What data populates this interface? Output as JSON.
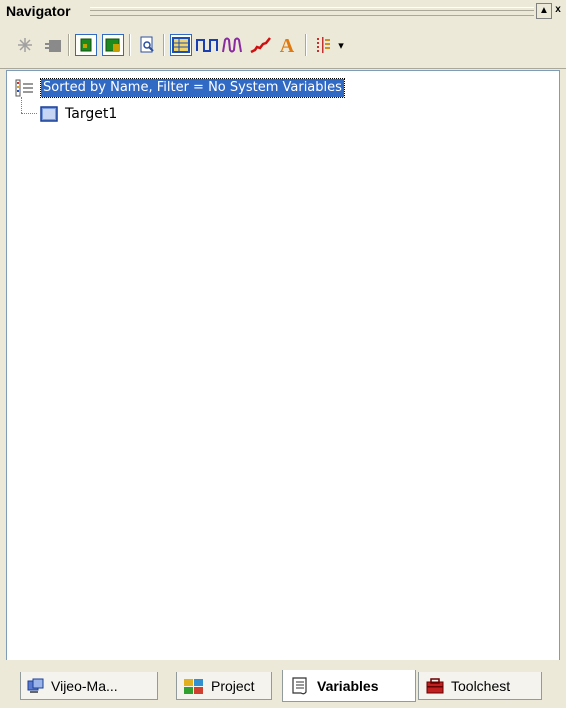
{
  "window": {
    "title": "Navigator",
    "dock_button": "▲",
    "close_button": "x"
  },
  "toolbar": {
    "tools": [
      {
        "icon": "spark-icon",
        "pressed": false
      },
      {
        "icon": "plugin-icon",
        "pressed": false
      },
      {
        "icon": "green-box-icon",
        "pressed": true
      },
      {
        "icon": "green-box-alt-icon",
        "pressed": true
      },
      {
        "icon": "preview-icon",
        "pressed": false
      },
      {
        "icon": "grid-view-icon",
        "pressed": true
      },
      {
        "icon": "pulse-blue-icon",
        "pressed": false
      },
      {
        "icon": "wave-purple-icon",
        "pressed": false
      },
      {
        "icon": "trend-red-icon",
        "pressed": false
      },
      {
        "icon": "text-a-icon",
        "pressed": false
      },
      {
        "icon": "columns-icon",
        "pressed": false
      }
    ],
    "dropdown_arrow": "▾"
  },
  "tree": {
    "root_label": "Sorted by Name, Filter = No System Variables",
    "child_label": "Target1"
  },
  "tabs": [
    {
      "label": "Vijeo-Ma...",
      "icon": "vijeo-icon",
      "active": false
    },
    {
      "label": "Project",
      "icon": "project-icon",
      "active": false
    },
    {
      "label": "Variables",
      "icon": "variables-icon",
      "active": true
    },
    {
      "label": "Toolchest",
      "icon": "toolchest-icon",
      "active": false
    }
  ]
}
